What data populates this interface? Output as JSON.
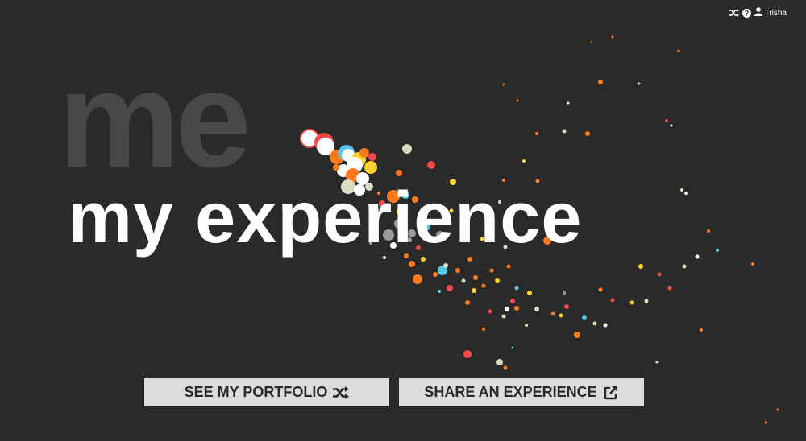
{
  "header": {
    "icons": [
      "shuffle-icon",
      "help-icon",
      "user-icon"
    ],
    "username": "Trisha"
  },
  "hero": {
    "background_word": "me",
    "title": "my experience"
  },
  "buttons": {
    "portfolio_label": "SEE MY PORTFOLIO",
    "portfolio_icon": "shuffle-icon",
    "share_label": "SHARE AN EXPERIENCE",
    "share_icon": "external-link-icon"
  },
  "colors": {
    "background": "#2b2a2a",
    "bg_word": "#494848",
    "title": "#ffffff",
    "button_bg": "#dcdcdc",
    "button_text": "#2b2a2a",
    "particle_palette": [
      "#ff7a1f",
      "#f04a4a",
      "#ffd42a",
      "#58c6e8",
      "#d8dcc0",
      "#ffffff",
      "#9a9a9a"
    ]
  }
}
